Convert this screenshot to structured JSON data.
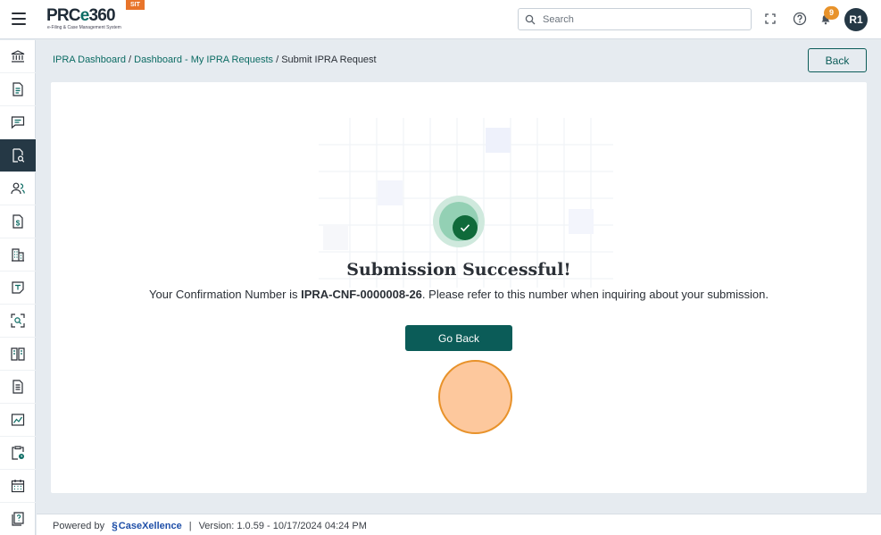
{
  "header": {
    "logo_text": "PRCe360",
    "logo_prefix": "PRC",
    "logo_e": "e",
    "logo_suffix": "360",
    "logo_subtitle": "e-Filing & Case Management System",
    "env_badge": "SIT",
    "search_placeholder": "Search",
    "notification_count": "9",
    "avatar_initials": "R1"
  },
  "sidebar": {
    "items": [
      {
        "icon": "bank-icon"
      },
      {
        "icon": "document-icon"
      },
      {
        "icon": "chat-icon"
      },
      {
        "icon": "document-search-icon",
        "active": true
      },
      {
        "icon": "users-icon"
      },
      {
        "icon": "invoice-icon"
      },
      {
        "icon": "building-icon"
      },
      {
        "icon": "note-icon"
      },
      {
        "icon": "scan-search-icon"
      },
      {
        "icon": "book-icon"
      },
      {
        "icon": "file-lines-icon"
      },
      {
        "icon": "chart-icon"
      },
      {
        "icon": "clipboard-clock-icon"
      },
      {
        "icon": "calendar-icon"
      },
      {
        "icon": "help-book-icon"
      }
    ]
  },
  "breadcrumb": {
    "item1": "IPRA Dashboard",
    "item2": "Dashboard - My IPRA Requests",
    "current": "Submit IPRA Request",
    "separator": "/"
  },
  "back_button": "Back",
  "success": {
    "title": "Submission Successful!",
    "message_prefix": "Your Confirmation Number is ",
    "confirmation_number": "IPRA-CNF-0000008-26",
    "message_suffix": ". Please refer to this number when inquiring about your submission.",
    "go_back_label": "Go Back"
  },
  "footer": {
    "powered_by": "Powered by",
    "brand": "CaseXellence",
    "separator": "|",
    "version": "Version: 1.0.59 - 10/17/2024 04:24 PM"
  },
  "colors": {
    "primary": "#0b5c58",
    "sidebar_active": "#253845",
    "badge": "#e8922a",
    "success": "#0f6a3a"
  }
}
